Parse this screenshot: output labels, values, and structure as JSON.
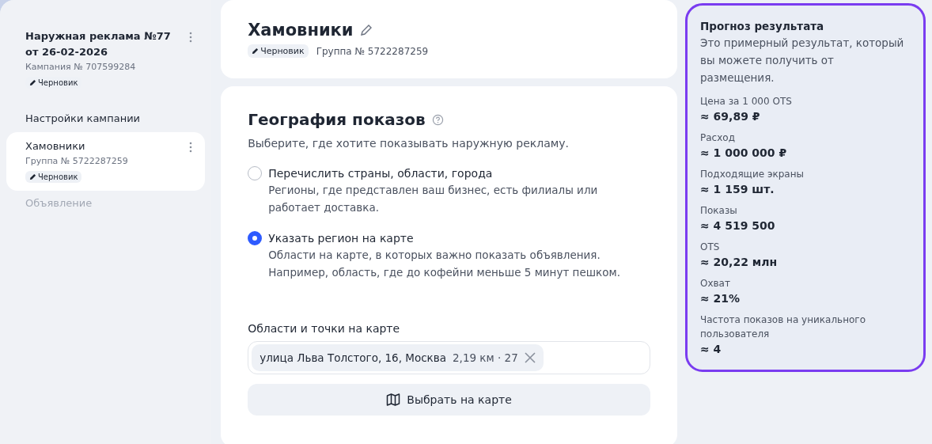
{
  "sidebar": {
    "campaign": {
      "title": "Наружная реклама №77 от 26-02-2026",
      "number": "Кампания № 707599284",
      "status": "Черновик"
    },
    "section_title": "Настройки кампании",
    "items": [
      {
        "kind": "group",
        "title": "Хамовники",
        "number": "Группа № 5722287259",
        "status": "Черновик",
        "selected": true,
        "disabled": false
      },
      {
        "kind": "link",
        "title": "Объявление",
        "selected": false,
        "disabled": true
      }
    ]
  },
  "header": {
    "title": "Хамовники",
    "status": "Черновик",
    "group": "Группа № 5722287259"
  },
  "geography": {
    "title": "География показов",
    "subtitle": "Выберите, где хотите показывать наружную рекламу.",
    "options": [
      {
        "label": "Перечислить страны, области, города",
        "description": "Регионы, где представлен ваш бизнес, есть филиалы или работает доставка.",
        "selected": false
      },
      {
        "label": "Указать регион на карте",
        "description": "Области на карте, в которых важно показать объявления. Например, область, где до кофейни меньше 5 минут пешком.",
        "selected": true
      }
    ],
    "field_label": "Области и точки на карте",
    "chips": [
      {
        "address": "улица Льва Толстого, 16, Москва",
        "detail": "2,19 км · 27"
      }
    ],
    "button": "Выбрать на карте"
  },
  "forecast": {
    "title": "Прогноз результата",
    "subtitle": "Это примерный результат, который вы можете получить от размещения.",
    "metrics": [
      {
        "label": "Цена за 1 000 OTS",
        "value": "≈ 69,89 ₽"
      },
      {
        "label": "Расход",
        "value": "≈ 1 000 000 ₽"
      },
      {
        "label": "Подходящие экраны",
        "value": "≈ 1 159 шт."
      },
      {
        "label": "Показы",
        "value": "≈ 4 519 500"
      },
      {
        "label": "OTS",
        "value": "≈ 20,22 млн"
      },
      {
        "label": "Охват",
        "value": "≈ 21%"
      },
      {
        "label": "Частота показов на уникального пользователя",
        "value": "≈ 4"
      }
    ]
  }
}
